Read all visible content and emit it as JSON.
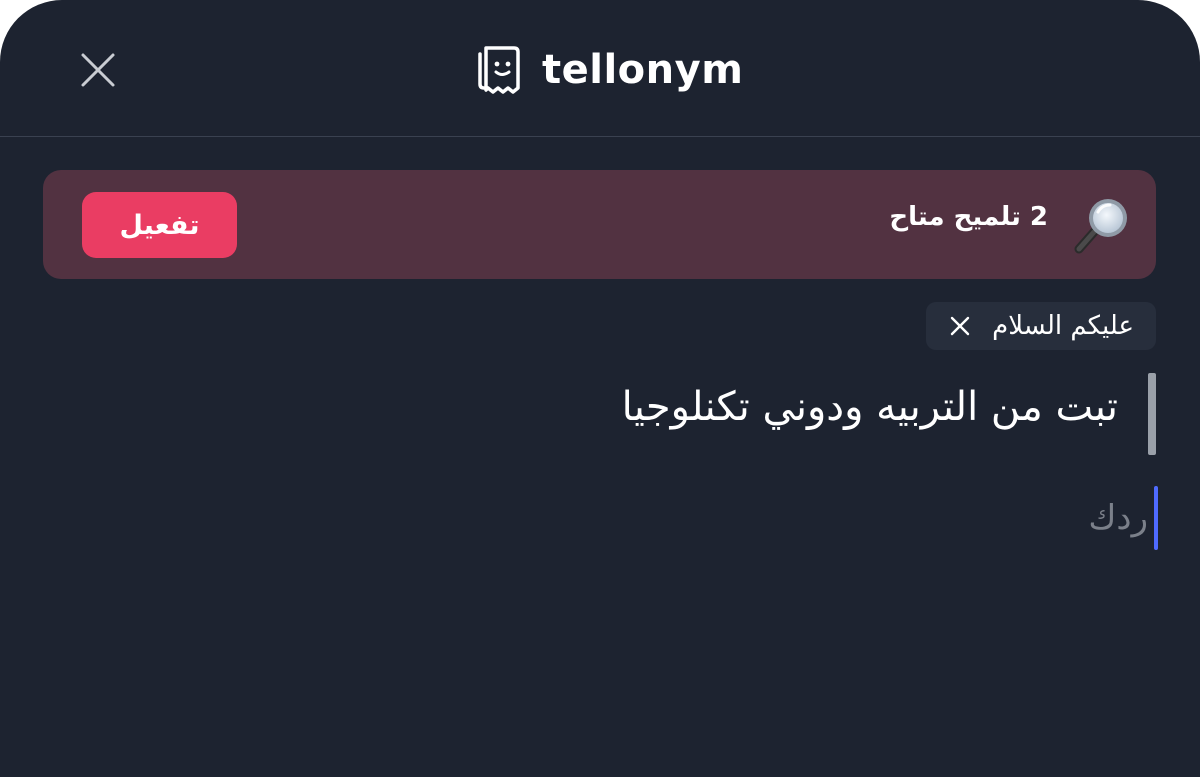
{
  "header": {
    "brand": "tellonym",
    "close_icon": "close-icon",
    "logo_icon": "tellonym-logo-icon"
  },
  "hint_bar": {
    "text": "2 تلميح متاح",
    "icon": "magnifier-icon",
    "activate_label": "تفعيل",
    "colors": {
      "background": "#523241",
      "button": "#ea3d63"
    }
  },
  "recipient_chip": {
    "label": "عليكم السلام",
    "close_icon": "close-icon"
  },
  "question": {
    "text": "تبت من التربيه ودوني تكنلوجيا"
  },
  "reply": {
    "value": "",
    "placeholder": "ردك",
    "caret_color": "#4f6bff"
  },
  "colors": {
    "background": "#1d2330",
    "divider": "#3a4150"
  }
}
